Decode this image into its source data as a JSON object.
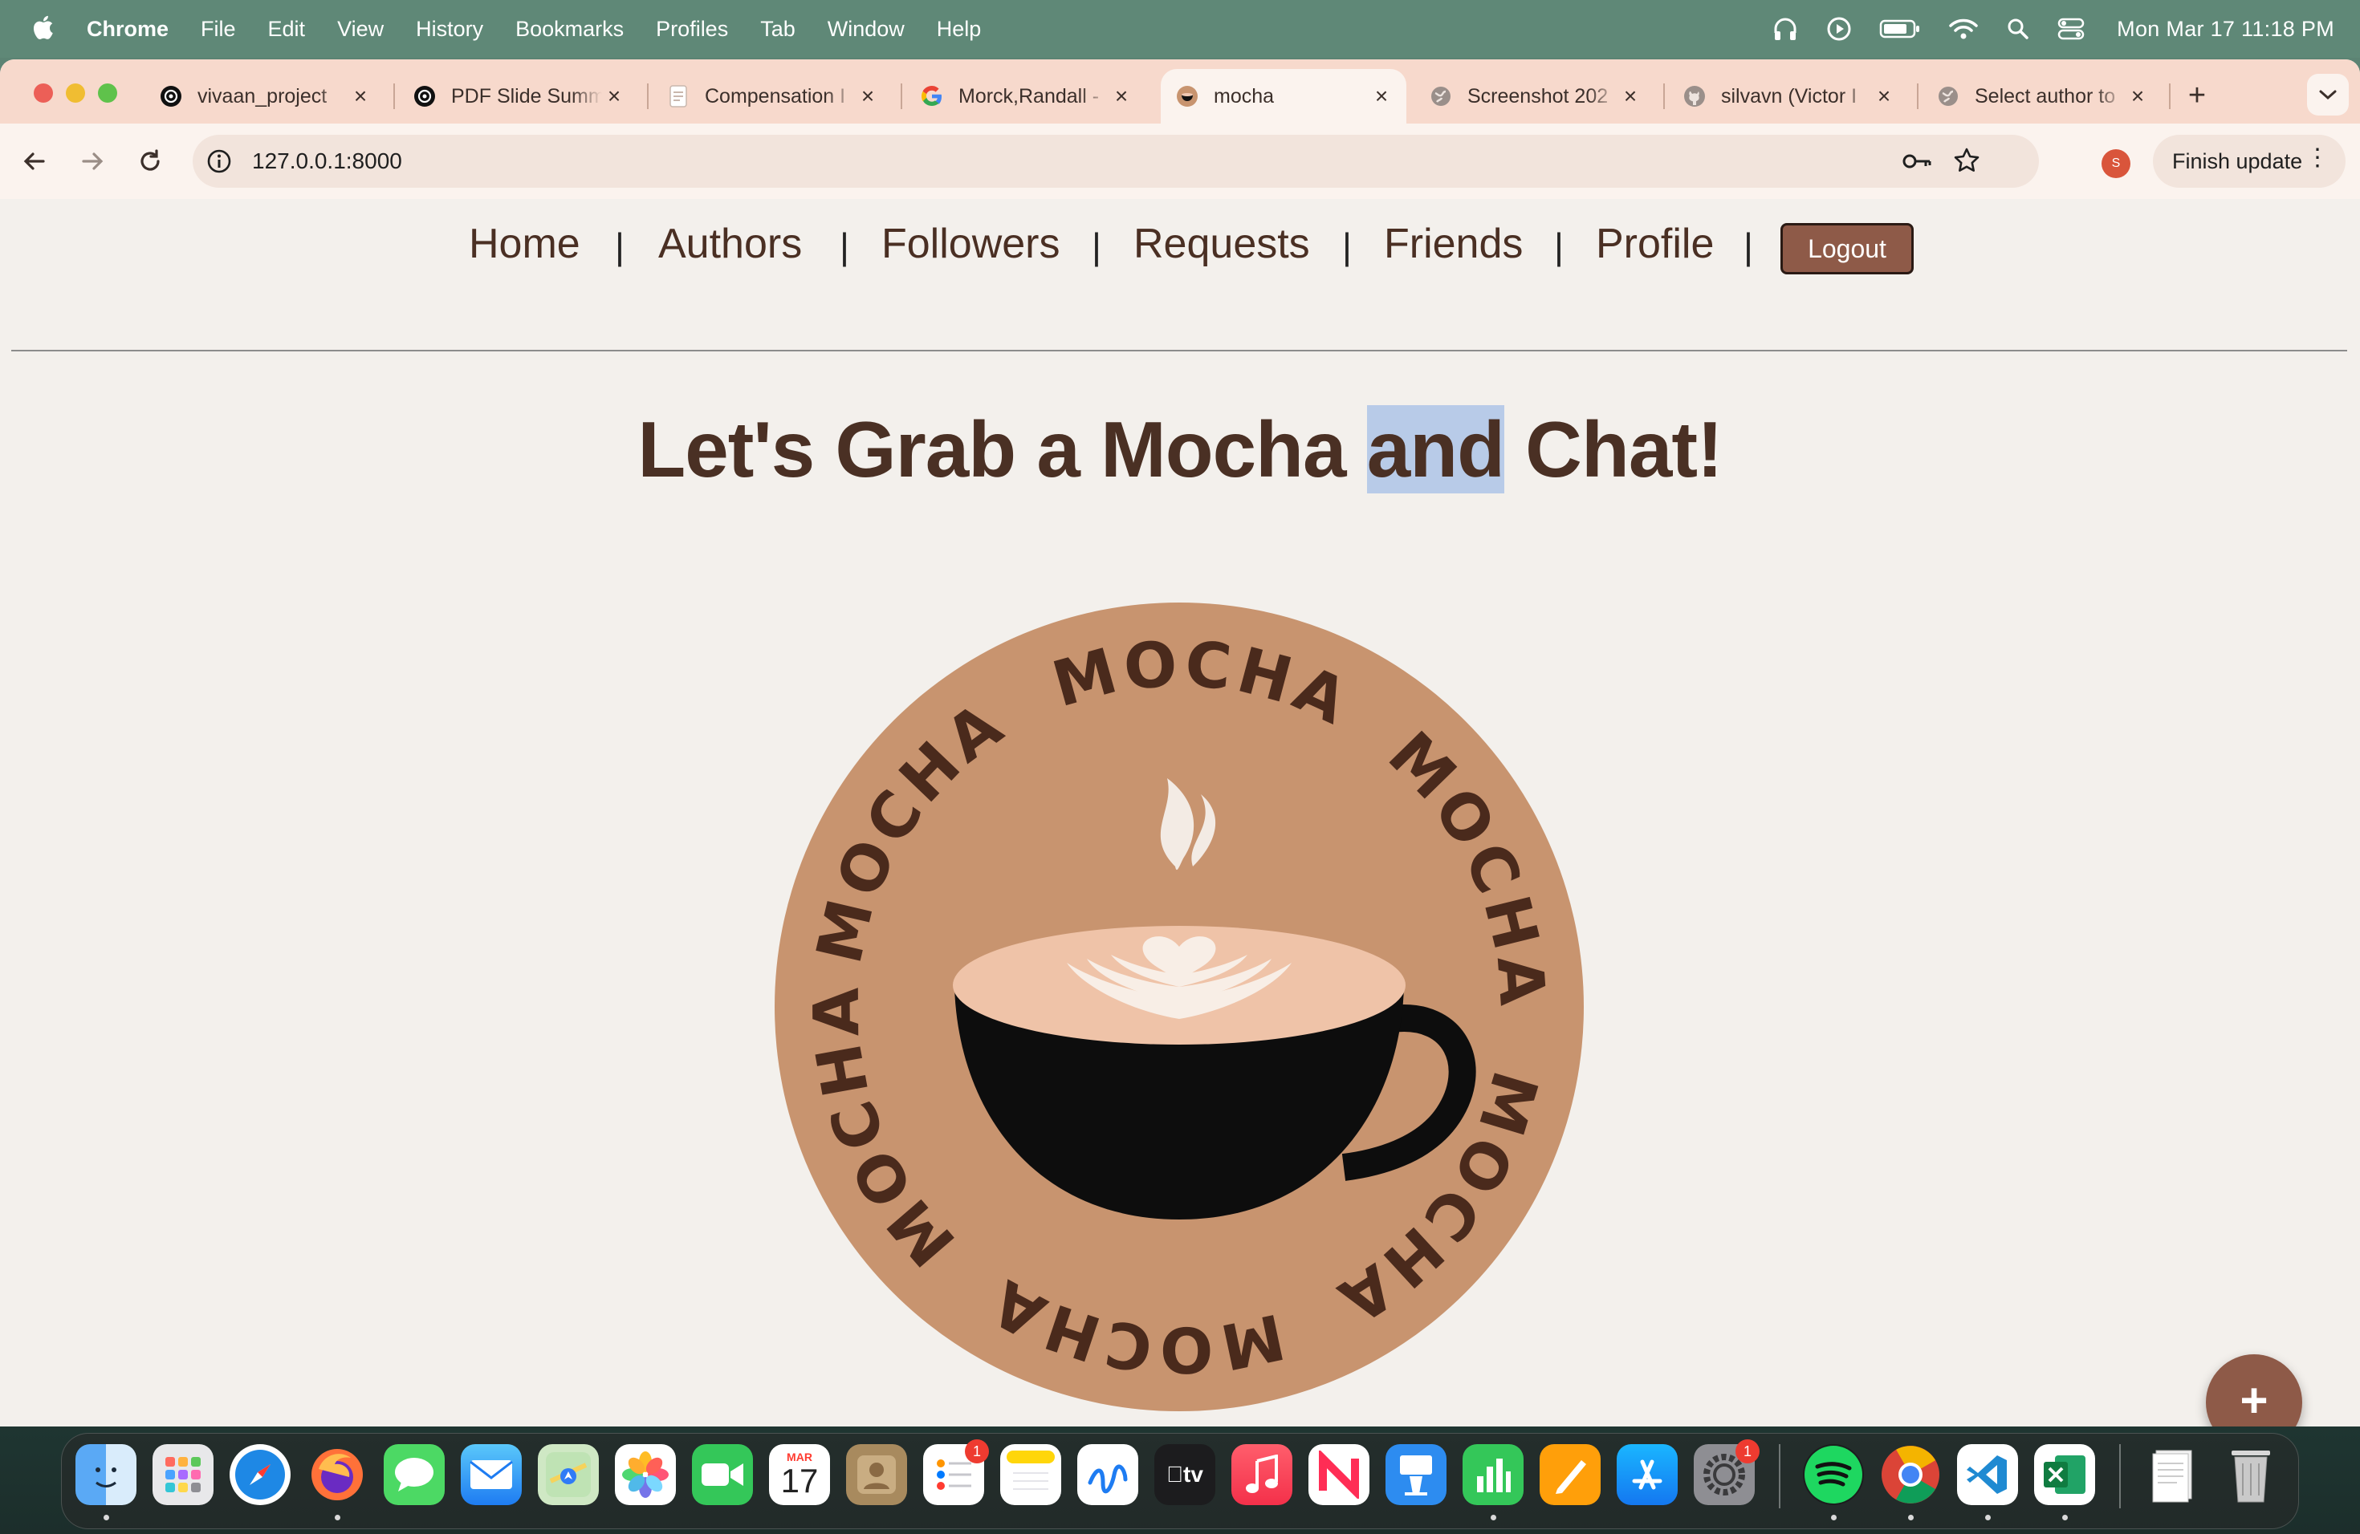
{
  "menubar": {
    "app_name": "Chrome",
    "menus": [
      "File",
      "Edit",
      "View",
      "History",
      "Bookmarks",
      "Profiles",
      "Tab",
      "Window",
      "Help"
    ],
    "clock": "Mon Mar 17  11:18 PM"
  },
  "tabs": [
    {
      "title": "vivaan_project",
      "icon": "openai-icon"
    },
    {
      "title": "PDF Slide Summ",
      "icon": "openai-icon"
    },
    {
      "title": "Compensation I",
      "icon": "doc-icon"
    },
    {
      "title": "Morck,Randall -",
      "icon": "google-icon"
    },
    {
      "title": "mocha",
      "icon": "mocha-icon",
      "active": true
    },
    {
      "title": "Screenshot 202",
      "icon": "globe-icon"
    },
    {
      "title": "silvavn (Victor I",
      "icon": "github-icon"
    },
    {
      "title": "Select author to",
      "icon": "globe-icon"
    }
  ],
  "toolbar": {
    "url": "127.0.0.1:8000",
    "profile_initial": "S",
    "finish_update": "Finish update"
  },
  "site": {
    "nav": [
      "Home",
      "Authors",
      "Followers",
      "Requests",
      "Friends",
      "Profile"
    ],
    "separator": "|",
    "logout": "Logout",
    "headline_before": "Let's Grab a Mocha ",
    "headline_selected": "and",
    "headline_after": " Chat!",
    "logo_text": "MOCHA",
    "fab_label": "+",
    "colors": {
      "accent": "#8e5a48",
      "text": "#4a3024",
      "logo_bg": "#c8946f"
    }
  },
  "dock": {
    "apps": [
      "Finder",
      "Launchpad",
      "Safari",
      "Firefox",
      "Messages",
      "Mail",
      "Maps",
      "Photos",
      "FaceTime",
      "Calendar",
      "Contacts",
      "Reminders",
      "Notes",
      "Freeform",
      "TV",
      "Music",
      "News",
      "Keynote",
      "Numbers",
      "Pages",
      "App Store",
      "System Settings",
      "Spotify",
      "Chrome",
      "VS Code",
      "Excel",
      "Downloads",
      "Trash"
    ],
    "calendar_month": "MAR",
    "calendar_day": "17",
    "tv_label": "tv",
    "reminders_badge": "1",
    "settings_badge": "1"
  }
}
